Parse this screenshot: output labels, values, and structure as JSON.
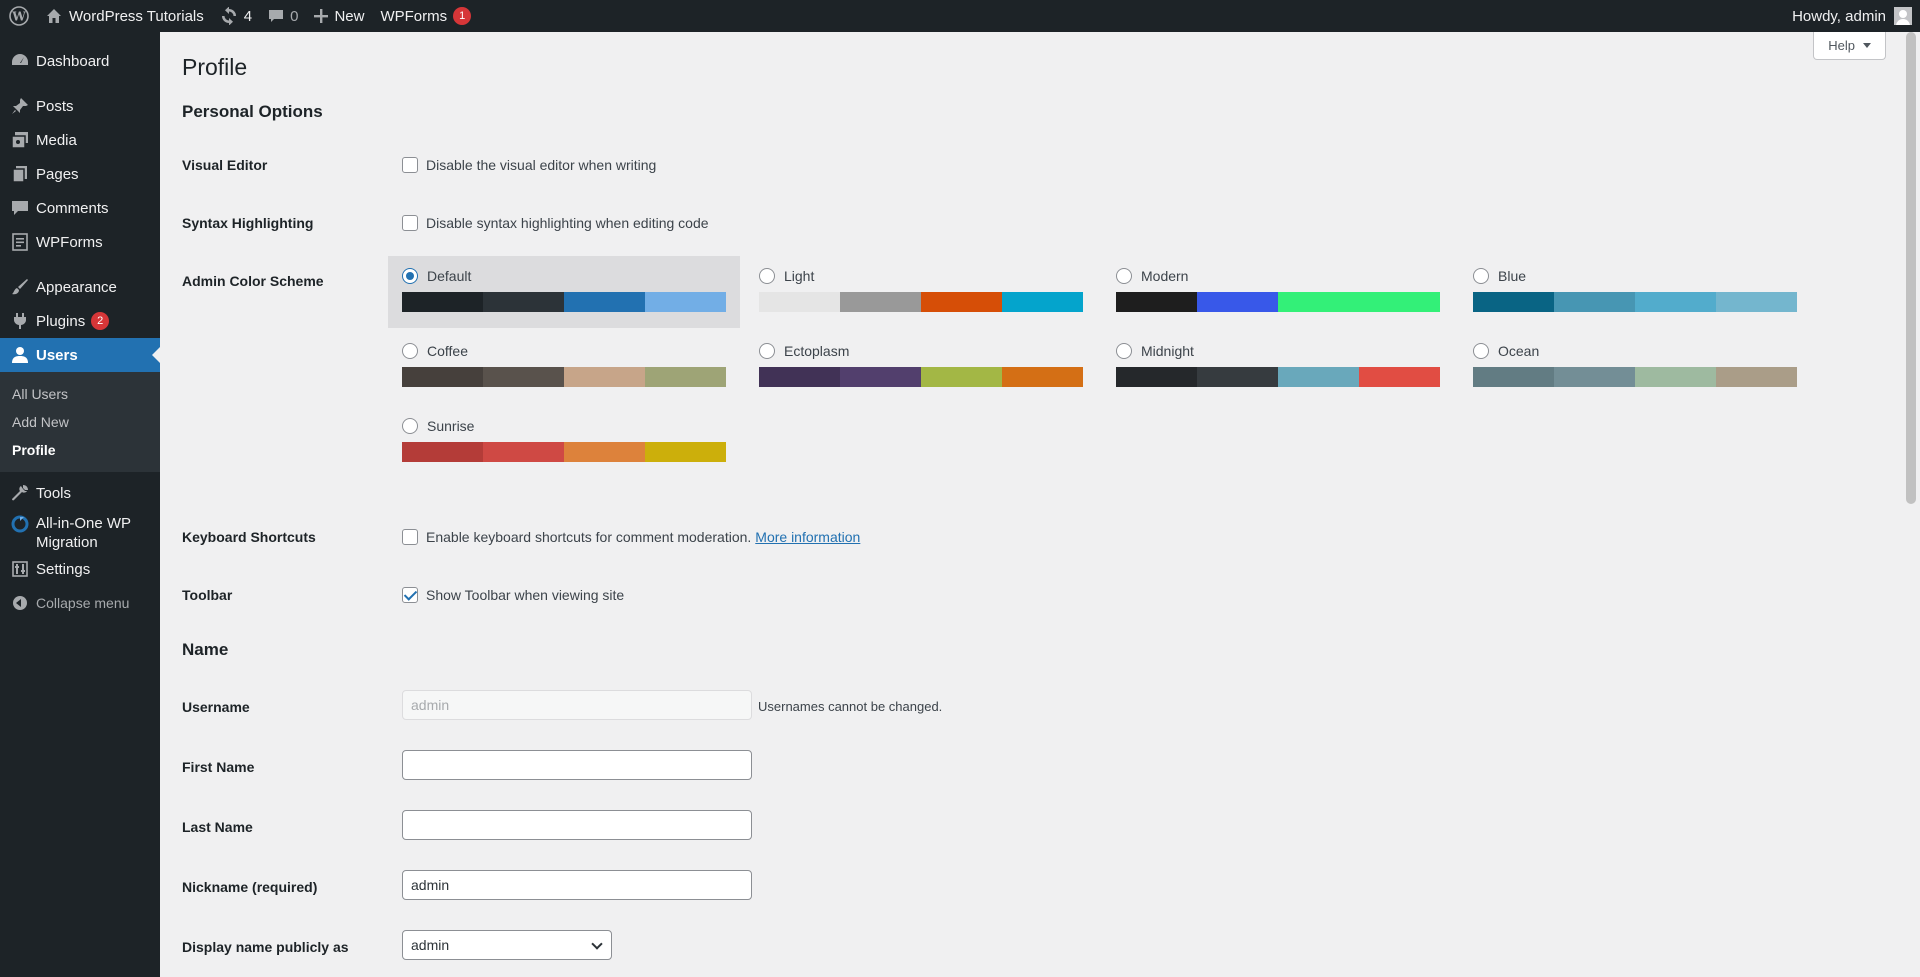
{
  "adminbar": {
    "site_name": "WordPress Tutorials",
    "updates_count": "4",
    "comments_count": "0",
    "new_label": "New",
    "wpforms_label": "WPForms",
    "wpforms_badge": "1",
    "howdy": "Howdy, admin"
  },
  "sidebar": {
    "dashboard": "Dashboard",
    "posts": "Posts",
    "media": "Media",
    "pages": "Pages",
    "comments": "Comments",
    "wpforms": "WPForms",
    "appearance": "Appearance",
    "plugins": "Plugins",
    "plugins_badge": "2",
    "users": "Users",
    "users_sub": [
      "All Users",
      "Add New",
      "Profile"
    ],
    "tools": "Tools",
    "migration": "All-in-One WP Migration",
    "settings": "Settings",
    "collapse": "Collapse menu"
  },
  "help": "Help",
  "page": {
    "title": "Profile",
    "personal_options": "Personal Options",
    "visual_editor_label": "Visual Editor",
    "visual_editor_text": "Disable the visual editor when writing",
    "syntax_label": "Syntax Highlighting",
    "syntax_text": "Disable syntax highlighting when editing code",
    "color_scheme_label": "Admin Color Scheme",
    "keyboard_label": "Keyboard Shortcuts",
    "keyboard_text": "Enable keyboard shortcuts for comment moderation.",
    "keyboard_link": "More information",
    "toolbar_label": "Toolbar",
    "toolbar_text": "Show Toolbar when viewing site",
    "name_heading": "Name",
    "username_label": "Username",
    "username_value": "admin",
    "username_hint": "Usernames cannot be changed.",
    "first_name_label": "First Name",
    "first_name_value": "",
    "last_name_label": "Last Name",
    "last_name_value": "",
    "nickname_label": "Nickname (required)",
    "nickname_value": "admin",
    "display_name_label": "Display name publicly as",
    "display_name_value": "admin"
  },
  "color_schemes": [
    {
      "name": "Default",
      "selected": true,
      "colors": [
        "#1d2327",
        "#2c3338",
        "#2271b1",
        "#72aee6"
      ]
    },
    {
      "name": "Light",
      "selected": false,
      "colors": [
        "#e5e5e5",
        "#999999",
        "#d64e07",
        "#04a4cc"
      ]
    },
    {
      "name": "Modern",
      "selected": false,
      "colors": [
        "#1e1e1e",
        "#3858e9",
        "#33f078",
        "#33f078"
      ]
    },
    {
      "name": "Blue",
      "selected": false,
      "colors": [
        "#096484",
        "#4796b3",
        "#52accc",
        "#74b6ce"
      ]
    },
    {
      "name": "Coffee",
      "selected": false,
      "colors": [
        "#46403c",
        "#59524c",
        "#c7a589",
        "#9ea476"
      ]
    },
    {
      "name": "Ectoplasm",
      "selected": false,
      "colors": [
        "#413256",
        "#523f6d",
        "#a3b745",
        "#d46f15"
      ]
    },
    {
      "name": "Midnight",
      "selected": false,
      "colors": [
        "#25282b",
        "#363b3f",
        "#69a8bb",
        "#e14d43"
      ]
    },
    {
      "name": "Ocean",
      "selected": false,
      "colors": [
        "#627c83",
        "#738e96",
        "#9ebaa0",
        "#aa9d88"
      ]
    },
    {
      "name": "Sunrise",
      "selected": false,
      "colors": [
        "#b43c38",
        "#cf4944",
        "#dd823b",
        "#ccaf0b"
      ]
    }
  ],
  "checkboxes": {
    "visual_editor": false,
    "syntax": false,
    "keyboard": false,
    "toolbar": true
  }
}
